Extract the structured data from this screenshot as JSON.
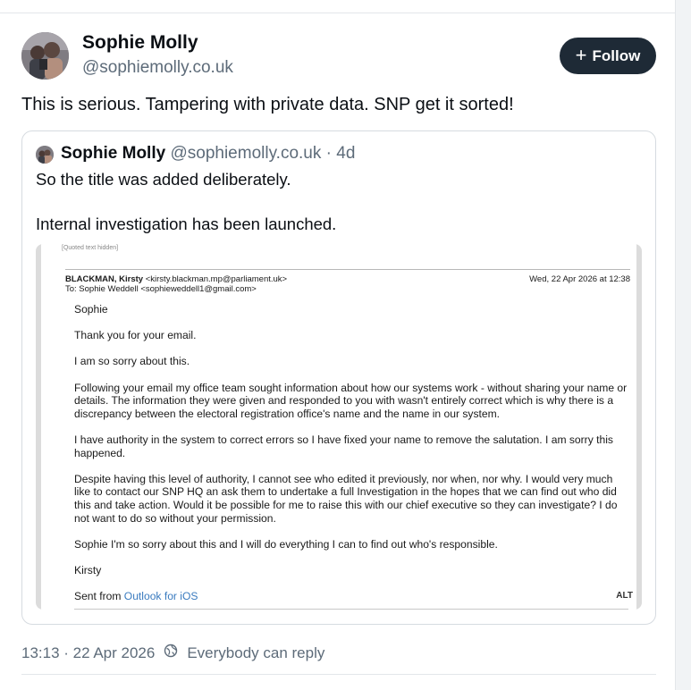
{
  "post": {
    "author_name": "Sophie Molly",
    "author_handle": "@sophiemolly.co.uk",
    "follow_label": "Follow",
    "text": "This is serious. Tampering with private data. SNP get it sorted!",
    "timestamp": "13:13 · 22 Apr 2026",
    "reply_setting": "Everybody can reply"
  },
  "quote": {
    "author_name": "Sophie Molly",
    "meta": "@sophiemolly.co.uk · 4d",
    "text": "So the title was added deliberately.\n\nInternal investigation has been launched.",
    "image": {
      "alt_badge": "ALT",
      "cut_line": "[Quoted text hidden]",
      "email": {
        "from_name": "BLACKMAN, Kirsty",
        "from_addr": "<kirsty.blackman.mp@parliament.uk>",
        "to": "To: Sophie Weddell <sophieweddell1@gmail.com>",
        "date": "Wed, 22 Apr 2026 at 12:38",
        "paragraphs": [
          "Sophie",
          "Thank you for your email.",
          "I am so sorry about this.",
          "Following your email my office team sought information about how our systems work - without sharing your name or details. The information they were given and responded to you with wasn't entirely correct which is why there is a discrepancy between the electoral registration office's name and the name in our system.",
          "I have authority in the system to correct errors so I have fixed your name to remove the salutation. I am sorry this happened.",
          "Despite having this level of authority, I cannot see who edited it previously, nor when, nor why. I would very much like to contact our SNP HQ an ask them to undertake a full Investigation in the hopes that we can find out who did this and take action. Would it be possible for me to raise this with our chief executive so they can investigate? I do not want to do so without your permission.",
          "Sophie I'm so sorry about this and I will do everything I can to find out who's responsible.",
          "Kirsty"
        ],
        "signature_prefix": "Sent from ",
        "signature_link": "Outlook for iOS"
      }
    }
  },
  "colors": {
    "follow_bg": "#1e2a36",
    "muted_text": "#5d6b79",
    "border": "#d6dbe0",
    "link": "#3a7bbf"
  },
  "icons": {
    "follow": "plus-icon",
    "reply_setting": "globe-icon"
  }
}
